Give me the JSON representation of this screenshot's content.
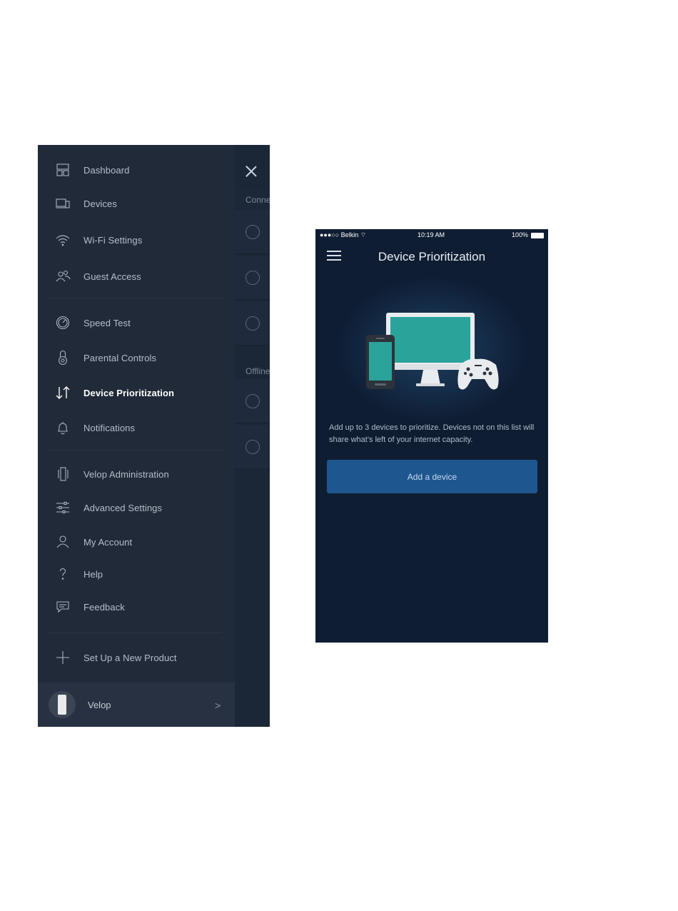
{
  "left_screen": {
    "drawer": {
      "items": [
        {
          "label": "Dashboard",
          "icon": "dashboard-icon",
          "active": false
        },
        {
          "label": "Devices",
          "icon": "devices-icon",
          "active": false
        },
        {
          "label": "Wi-Fi Settings",
          "icon": "wifi-icon",
          "active": false
        },
        {
          "label": "Guest Access",
          "icon": "guest-access-icon",
          "active": false
        },
        {
          "label": "Speed Test",
          "icon": "speed-test-icon",
          "active": false
        },
        {
          "label": "Parental Controls",
          "icon": "parental-controls-icon",
          "active": false
        },
        {
          "label": "Device Prioritization",
          "icon": "prioritization-arrows-icon",
          "active": true
        },
        {
          "label": "Notifications",
          "icon": "bell-icon",
          "active": false
        },
        {
          "label": "Velop Administration",
          "icon": "velop-admin-icon",
          "active": false
        },
        {
          "label": "Advanced Settings",
          "icon": "sliders-icon",
          "active": false
        },
        {
          "label": "My Account",
          "icon": "user-icon",
          "active": false
        },
        {
          "label": "Help",
          "icon": "question-icon",
          "active": false
        },
        {
          "label": "Feedback",
          "icon": "chat-icon",
          "active": false
        },
        {
          "label": "Set Up a New Product",
          "icon": "plus-icon",
          "active": false
        }
      ],
      "profile": {
        "label": "Velop",
        "chevron": ">"
      }
    },
    "background_panel": {
      "section_connected": "Conne",
      "section_offline": "Offline"
    }
  },
  "right_screen": {
    "status_bar": {
      "carrier": "●●●○○ Belkin ⌔",
      "time": "10:19 AM",
      "battery": "100%"
    },
    "title": "Device Prioritization",
    "description": "Add up to 3 devices to prioritize. Devices not on this list will share what’s left of your internet capacity.",
    "add_button_label": "Add a device"
  },
  "colors": {
    "drawer_bg": "#212a38",
    "screen_bg": "#0f1d33",
    "button_bg": "#1e5690",
    "illustration_teal": "#2aa39b"
  }
}
